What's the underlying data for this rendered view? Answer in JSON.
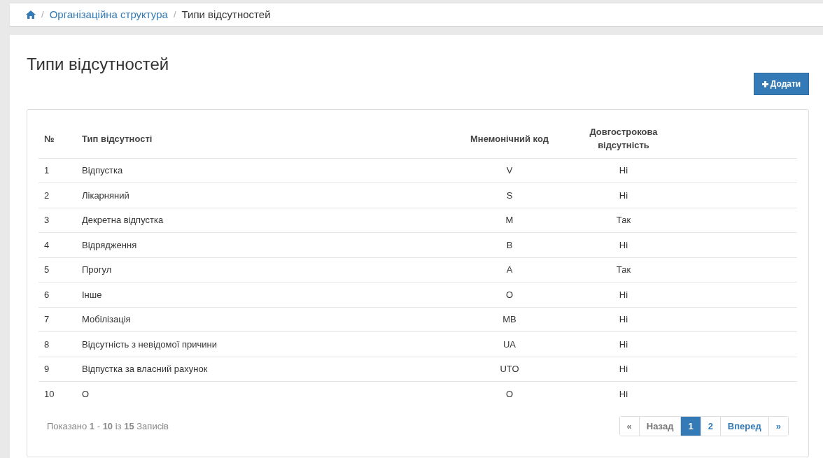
{
  "breadcrumb_separator": "/",
  "breadcrumb": [
    {
      "label": "Організаційна структура",
      "kind": "link"
    },
    {
      "label": "Типи відсутностей",
      "kind": "current"
    }
  ],
  "title": "Типи відсутностей",
  "add_button": "Додати",
  "table": {
    "columns": [
      "№",
      "Тип відсутності",
      "Мнемонічний код",
      "Довгострокова відсутність"
    ],
    "rows": [
      [
        "1",
        "Відпустка",
        "V",
        "Ні"
      ],
      [
        "2",
        "Лікарняний",
        "S",
        "Ні"
      ],
      [
        "3",
        "Декретна відпустка",
        "M",
        "Так"
      ],
      [
        "4",
        "Відрядження",
        "B",
        "Ні"
      ],
      [
        "5",
        "Прогул",
        "A",
        "Так"
      ],
      [
        "6",
        "Інше",
        "O",
        "Ні"
      ],
      [
        "7",
        "Мобілізація",
        "MB",
        "Ні"
      ],
      [
        "8",
        "Відсутність з невідомої причини",
        "UA",
        "Ні"
      ],
      [
        "9",
        "Відпустка за власний рахунок",
        "UTO",
        "Ні"
      ],
      [
        "10",
        "O",
        "O",
        "Ні"
      ]
    ]
  },
  "summary": "Показано **1** - **10** із **15** Записів",
  "pagination": [
    {
      "label": "«",
      "selected": false,
      "disabled": true
    },
    {
      "label": "Назад",
      "selected": false,
      "disabled": true
    },
    {
      "label": "1",
      "selected": true,
      "disabled": false
    },
    {
      "label": "2",
      "selected": false,
      "disabled": false
    },
    {
      "label": "Вперед",
      "selected": false,
      "disabled": false
    },
    {
      "label": "»",
      "selected": false,
      "disabled": false
    }
  ]
}
